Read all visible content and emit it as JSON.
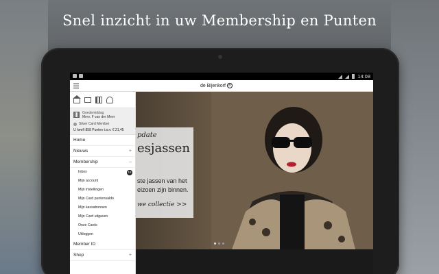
{
  "headline": "Snel inzicht in uw Membership en Punten",
  "status_bar": {
    "time": "14:08"
  },
  "app_bar": {
    "brand": "de Bijenkorf"
  },
  "member_panel": {
    "greeting": "Goedemiddag",
    "name": "Mevr. F van der Meer",
    "card_level": "Silver Card Member",
    "points_text": "U heeft 858 Punten t.w.v. € 21,45"
  },
  "menu": {
    "home": "Home",
    "nieuw": "Nieuws",
    "membership": "Membership",
    "membership_items": [
      "Inbox",
      "Mijn account",
      "Mijn instellingen",
      "Mijn Card puntensaldo",
      "Mijn kassabonnen",
      "Mijn Card uitgaven",
      "Onze Cards",
      "Uitloggen"
    ],
    "inbox_badge": "15",
    "member_id": "Member ID",
    "shop": "Shop"
  },
  "promo": {
    "overline": "pdate",
    "title": "esjassen",
    "body_line1": "ste jassen van het",
    "body_line2": "eizoen zijn binnen.",
    "cta": "we collectie >>"
  }
}
